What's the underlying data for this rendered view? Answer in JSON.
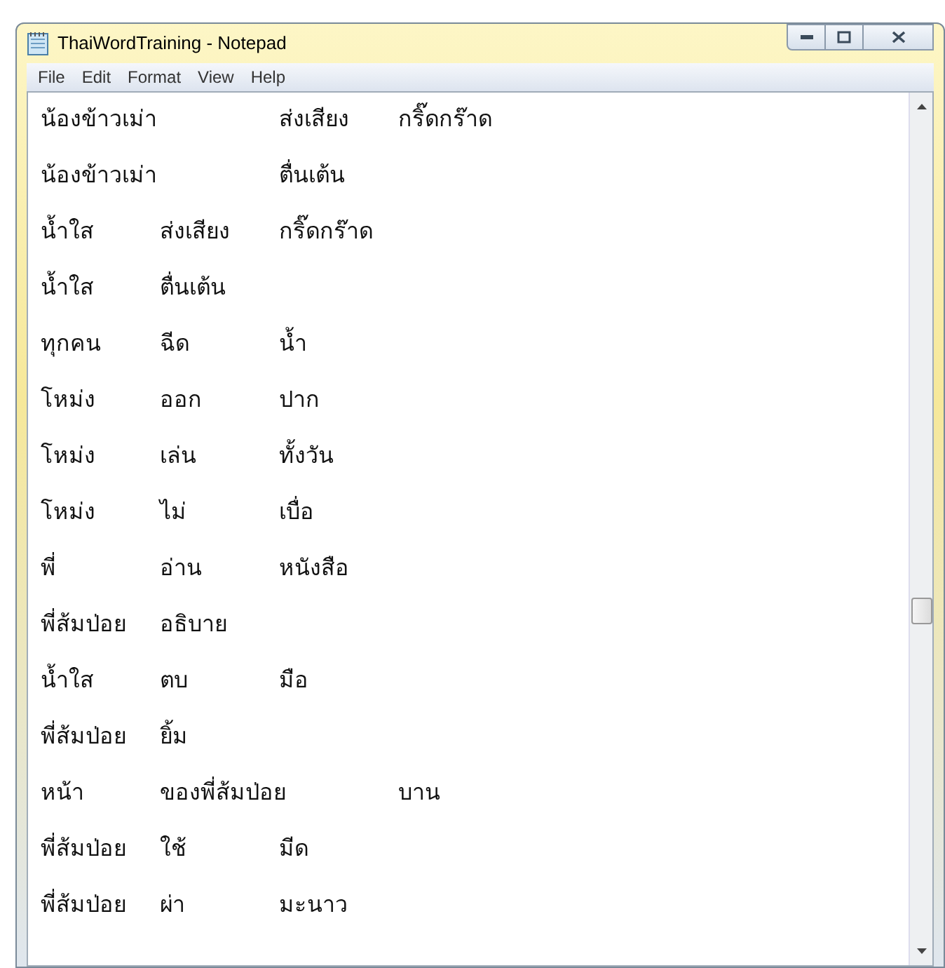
{
  "window": {
    "title": "ThaiWordTraining - Notepad"
  },
  "menu": [
    "File",
    "Edit",
    "Format",
    "View",
    "Help"
  ],
  "lines": [
    "น้องข้าวเม่า\tส่งเสียง\tกริ๊ดกร๊าด",
    "น้องข้าวเม่า\tตื่นเต้น",
    "น้ำใส\tส่งเสียง\tกริ๊ดกร๊าด",
    "น้ำใส\tตื่นเต้น",
    "ทุกคน\tฉีด\tน้ำ",
    "โหม่ง\tออก\tปาก",
    "โหม่ง\tเล่น\tทั้งวัน",
    "โหม่ง\tไม่\tเบื่อ",
    "พี่\tอ่าน\tหนังสือ",
    "พี่ส้มป่อย\tอธิบาย",
    "น้ำใส\tตบ\tมือ",
    "พี่ส้มป่อย\tยิ้ม",
    "หน้า\tของพี่ส้มป่อย\tบาน",
    "พี่ส้มป่อย\tใช้\tมีด",
    "พี่ส้มป่อย\tผ่า\tมะนาว"
  ]
}
